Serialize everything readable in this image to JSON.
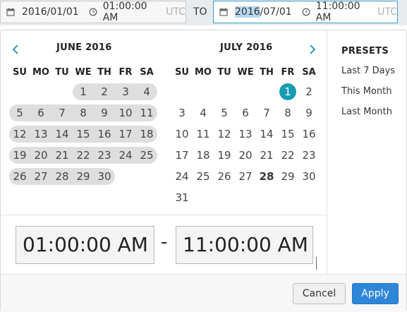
{
  "range": {
    "from_date": "2016/01/01",
    "from_time": "01:00:00 AM",
    "from_tz": "UTC",
    "to_label": "TO",
    "to_date_year": "2016",
    "to_date_rest": "/07/01",
    "to_time": "11:00:00 AM",
    "to_tz": "UTC"
  },
  "calendar": {
    "weekdays": [
      "SU",
      "MO",
      "TU",
      "WE",
      "TH",
      "FR",
      "SA"
    ],
    "left": {
      "title": "JUNE 2016",
      "rows": [
        [
          "",
          "",
          "",
          "1",
          "2",
          "3",
          "4"
        ],
        [
          "5",
          "6",
          "7",
          "8",
          "9",
          "10",
          "11"
        ],
        [
          "12",
          "13",
          "14",
          "15",
          "16",
          "17",
          "18"
        ],
        [
          "19",
          "20",
          "21",
          "22",
          "23",
          "24",
          "25"
        ],
        [
          "26",
          "27",
          "28",
          "29",
          "30",
          "",
          ""
        ]
      ]
    },
    "right": {
      "title": "JULY 2016",
      "rows": [
        [
          "",
          "",
          "",
          "",
          "",
          "1",
          "2"
        ],
        [
          "3",
          "4",
          "5",
          "6",
          "7",
          "8",
          "9"
        ],
        [
          "10",
          "11",
          "12",
          "13",
          "14",
          "15",
          "16"
        ],
        [
          "17",
          "18",
          "19",
          "20",
          "21",
          "22",
          "23"
        ],
        [
          "24",
          "25",
          "26",
          "27",
          "28",
          "29",
          "30"
        ],
        [
          "31",
          "",
          "",
          "",
          "",
          "",
          ""
        ]
      ],
      "selected_day": "1",
      "today_day": "28"
    }
  },
  "presets": {
    "title": "PRESETS",
    "items": [
      "Last 7 Days",
      "This Month",
      "Last Month"
    ]
  },
  "time": {
    "start": "01:00:00 AM",
    "separator": "-",
    "end": "11:00:00 AM"
  },
  "footer": {
    "cancel_label": "Cancel",
    "apply_label": "Apply"
  },
  "icons": {
    "calendar": "calendar-icon",
    "clock": "clock-icon",
    "prev": "chevron-left-icon",
    "next": "chevron-right-icon"
  },
  "colors": {
    "accent": "#2e86d8",
    "selected": "#1a9bb4",
    "range_band": "#dedede",
    "focus_border": "#3c9ad1"
  }
}
